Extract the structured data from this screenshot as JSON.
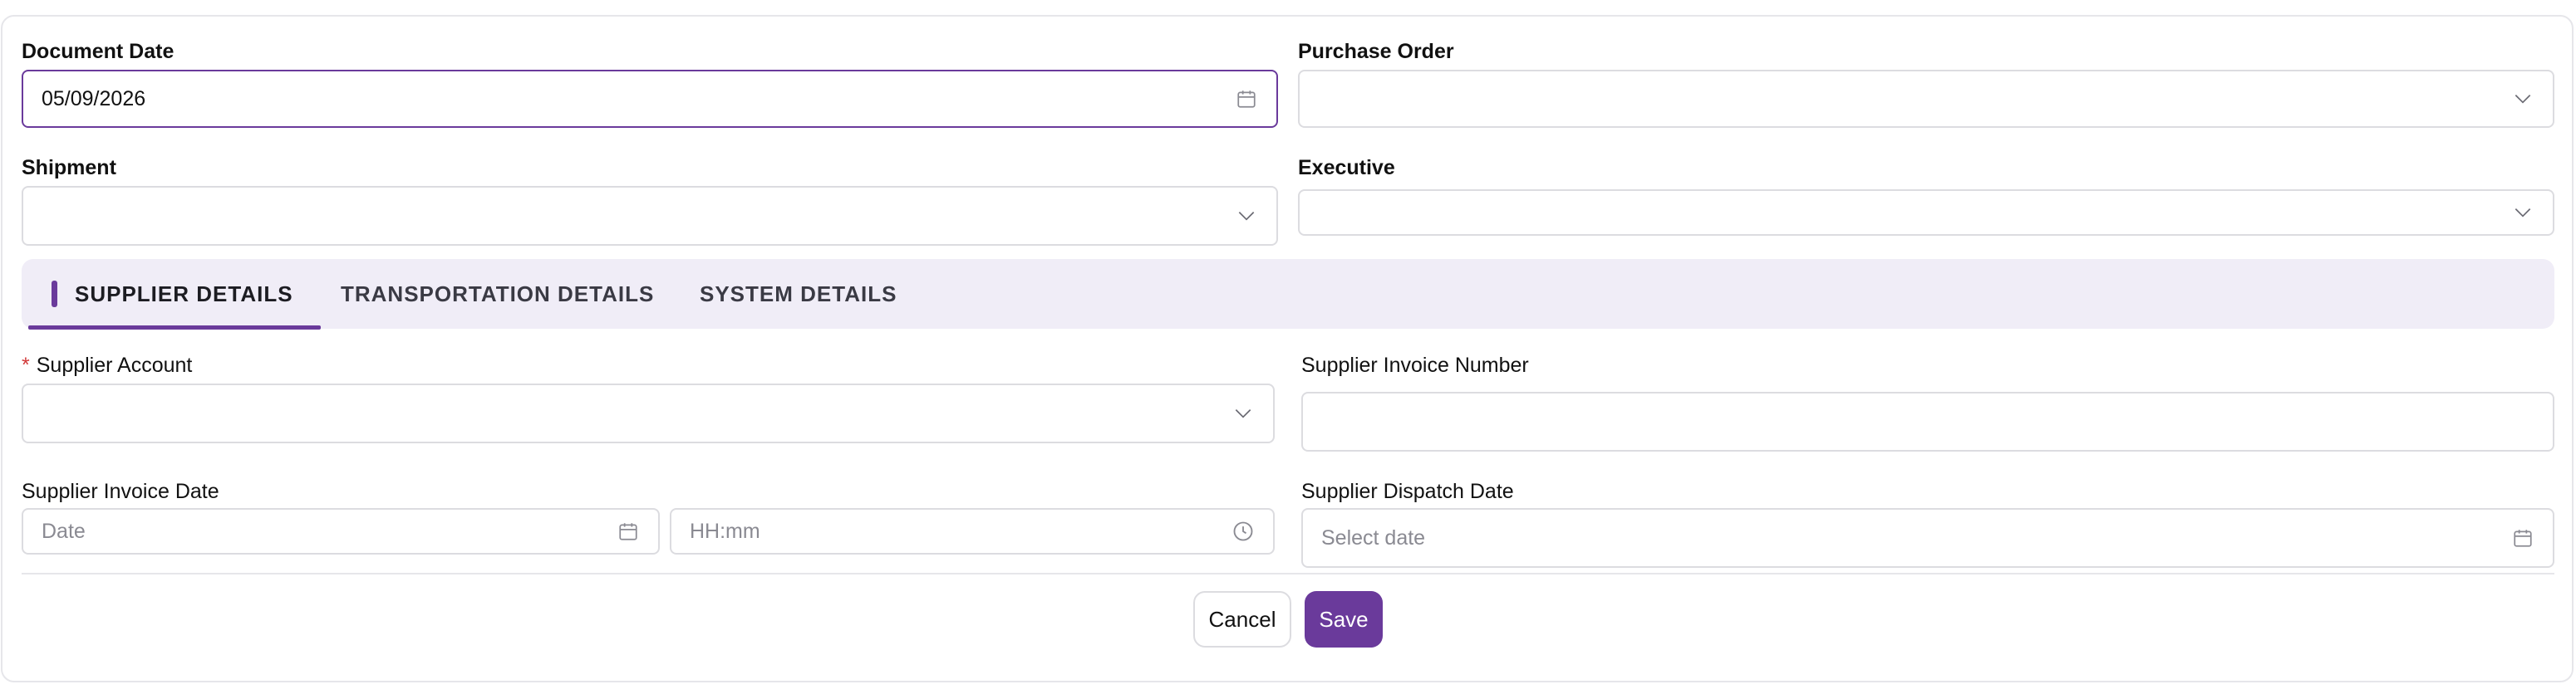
{
  "fields": {
    "document_date": {
      "label": "Document Date",
      "value": "05/09/2026"
    },
    "purchase_order": {
      "label": "Purchase Order",
      "value": ""
    },
    "shipment": {
      "label": "Shipment",
      "value": ""
    },
    "executive": {
      "label": "Executive",
      "value": ""
    }
  },
  "tabs": [
    {
      "label": "SUPPLIER DETAILS",
      "active": true
    },
    {
      "label": "TRANSPORTATION DETAILS",
      "active": false
    },
    {
      "label": "SYSTEM DETAILS",
      "active": false
    }
  ],
  "supplier": {
    "account": {
      "required_mark": "*",
      "label": "Supplier Account",
      "value": ""
    },
    "invoice_number": {
      "label": "Supplier Invoice Number",
      "value": ""
    },
    "invoice_date": {
      "label": "Supplier Invoice Date",
      "date_placeholder": "Date",
      "time_placeholder": "HH:mm"
    },
    "dispatch_date": {
      "label": "Supplier Dispatch Date",
      "placeholder": "Select date"
    }
  },
  "actions": {
    "cancel_label": "Cancel",
    "save_label": "Save"
  },
  "colors": {
    "accent": "#6a3a9b",
    "tab_bg": "#f0edf7",
    "required": "#d23a3a"
  },
  "icons": [
    "calendar-icon",
    "chevron-down-icon",
    "clock-icon"
  ]
}
